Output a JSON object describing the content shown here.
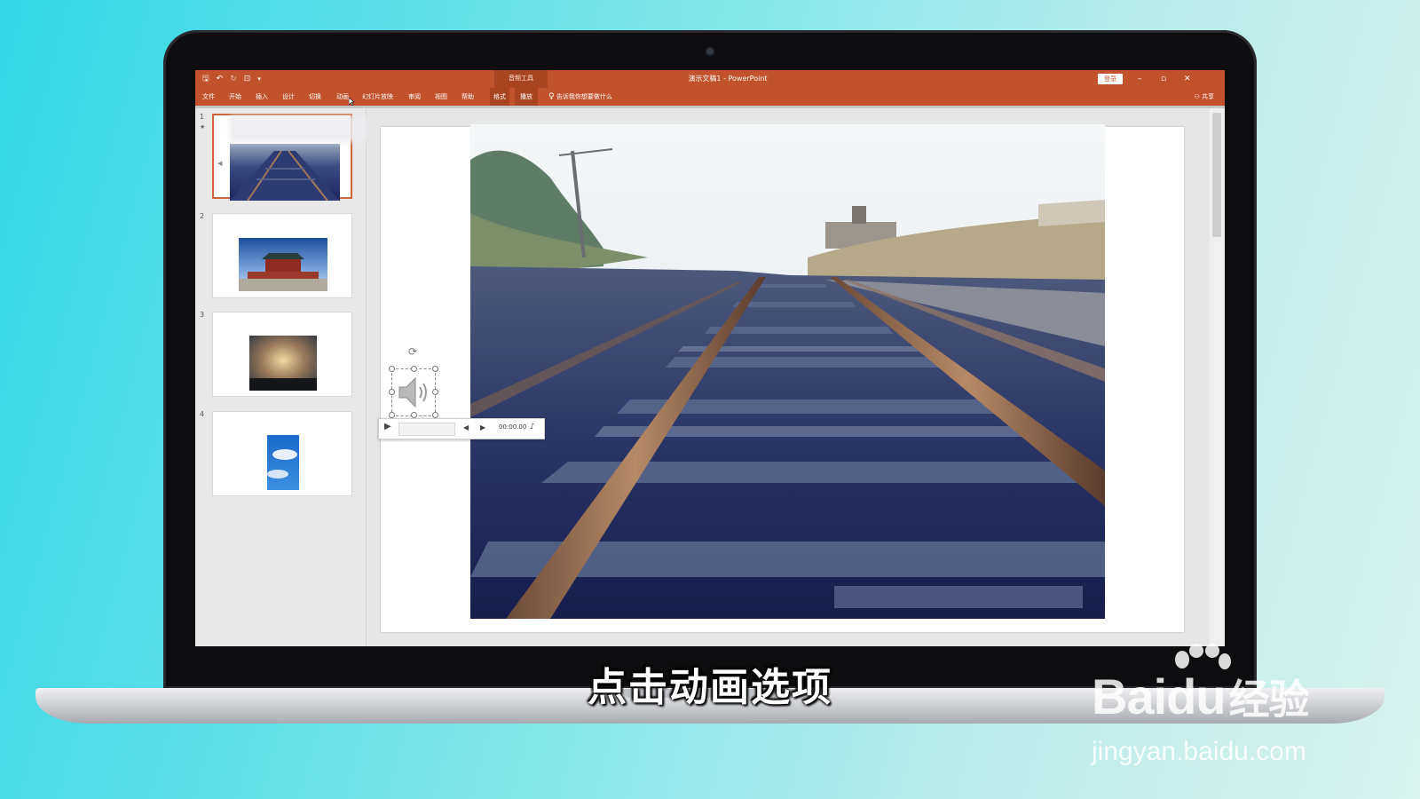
{
  "titlebar": {
    "contextual_tab_group": "音频工具",
    "document_title": "演示文稿1 - PowerPoint",
    "login_button": "登录",
    "minimize": "–",
    "restore": "▫",
    "close": "✕",
    "accent_color": "#c1522b"
  },
  "ribbon": {
    "tabs": [
      "文件",
      "开始",
      "插入",
      "设计",
      "切换",
      "动画",
      "幻灯片放映",
      "审阅",
      "视图",
      "帮助",
      "格式",
      "播放"
    ],
    "tell_me": "告诉我你想要做什么",
    "share": "共享"
  },
  "slides": [
    {
      "number": "1",
      "image": "railway-thumbnail",
      "selected": true
    },
    {
      "number": "2",
      "image": "tiananmen-thumbnail",
      "selected": false
    },
    {
      "number": "3",
      "image": "sunset-clouds-thumbnail",
      "selected": false
    },
    {
      "number": "4",
      "image": "blue-sky-thumbnail",
      "selected": false
    }
  ],
  "main_slide": {
    "image": "railway-tracks-photo"
  },
  "audio_player": {
    "time": "00:00.00",
    "play_icon": "play-icon",
    "back_icon": "step-back-icon",
    "forward_icon": "step-forward-icon",
    "volume_icon": "volume-icon"
  },
  "subtitle": "点击动画选项",
  "watermark": {
    "logo_latin": "Bai",
    "logo_latin2": "du",
    "logo_cn": "经验",
    "url": "jingyan.baidu.com"
  }
}
